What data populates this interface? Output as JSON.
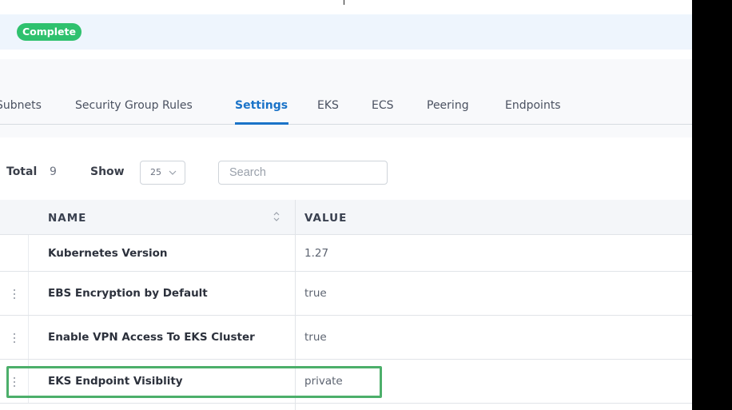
{
  "status": {
    "badge": "Complete"
  },
  "tabs": [
    {
      "label": "Subnets",
      "active": false
    },
    {
      "label": "Security Group Rules",
      "active": false
    },
    {
      "label": "Settings",
      "active": true
    },
    {
      "label": "EKS",
      "active": false
    },
    {
      "label": "ECS",
      "active": false
    },
    {
      "label": "Peering",
      "active": false
    },
    {
      "label": "Endpoints",
      "active": false
    }
  ],
  "toolbar": {
    "total_label": "Total",
    "total_value": "9",
    "show_label": "Show",
    "page_size": "25",
    "search_placeholder": "Search"
  },
  "table": {
    "columns": [
      "NAME",
      "VALUE"
    ],
    "rows": [
      {
        "name": "Kubernetes Version",
        "value": "1.27"
      },
      {
        "name": "EBS Encryption by Default",
        "value": "true"
      },
      {
        "name": "Enable VPN Access To EKS Cluster",
        "value": "true"
      },
      {
        "name": "EKS Endpoint Visiblity",
        "value": "private",
        "highlighted": true
      }
    ]
  },
  "colors": {
    "accent": "#1a73c8",
    "status_green": "#2fc16e",
    "highlight_green": "#4caf6a",
    "banner_bg": "#eef5fd"
  },
  "icons": [
    "chevron-down-icon",
    "sort-icon",
    "kebab-menu-icon"
  ]
}
